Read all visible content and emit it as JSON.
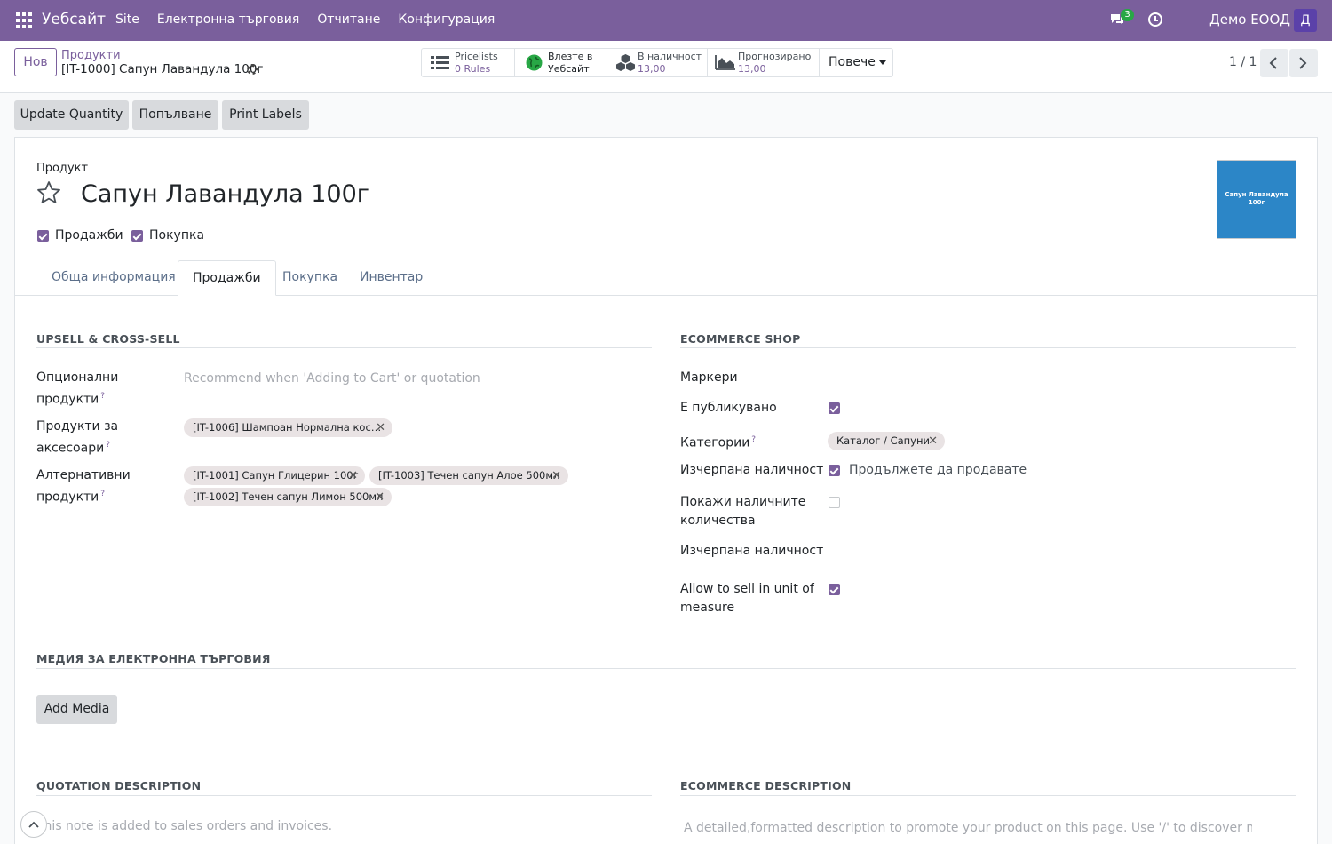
{
  "navbar": {
    "brand": "Уебсайт",
    "menu": [
      "Site",
      "Електронна търговия",
      "Отчитане",
      "Конфигурация"
    ],
    "chat_count": "3",
    "company": "Демо ЕООД",
    "avatar_letter": "Д"
  },
  "control_panel": {
    "new_button": "Нов",
    "breadcrumb_parent": "Продукти",
    "breadcrumb_current": "[IT-1000] Сапун Лавандула 100г",
    "stats": {
      "pricelists_label": "Pricelists",
      "pricelists_value": "0 Rules",
      "website_line1": "Влезте в",
      "website_line2": "Уебсайт",
      "onhand_label": "В наличност",
      "onhand_value": "13,00",
      "forecast_label": "Прогнозирано",
      "forecast_value": "13,00",
      "more": "Повече"
    },
    "pager": "1 / 1"
  },
  "actions": [
    "Update Quantity",
    "Попълване",
    "Print Labels"
  ],
  "form": {
    "product_label": "Продукт",
    "title": "Сапун Лавандула 100г",
    "image_text": "Сапун Лавандула 100г",
    "sales_check_label": "Продажби",
    "purchase_check_label": "Покупка",
    "tabs": [
      "Обща информация",
      "Продажби",
      "Покупка",
      "Инвентар"
    ],
    "active_tab": "Продажби",
    "upsell": {
      "title": "UPSELL & CROSS-SELL",
      "optional_label": "Опционални продукти",
      "optional_placeholder": "Recommend when 'Adding to Cart' or quotation",
      "accessory_label": "Продукти за аксесоари",
      "accessory_tags": [
        "[IT-1006] Шампоан Нормална кос…"
      ],
      "alternative_label": "Алтернативни продукти",
      "alternative_tags": [
        "[IT-1001] Сапун Глицерин 100г",
        "[IT-1003] Течен сапун Алое 500мл",
        "[IT-1002] Течен сапун Лимон 500мл"
      ]
    },
    "ecommerce": {
      "title": "ECOMMERCE SHOP",
      "markers_label": "Маркери",
      "published_label": "Е публикувано",
      "categories_label": "Категории",
      "category_tag": "Каталог / Сапуни",
      "out_of_stock_label": "Изчерпана наличност",
      "continue_selling": "Продължете да продавате",
      "show_qty_label": "Покажи наличните количества",
      "out_of_stock_msg_label": "Изчерпана наличност",
      "sell_uom_label": "Allow to sell in unit of measure"
    },
    "media": {
      "title": "МЕДИЯ ЗА ЕЛЕКТРОННА ТЪРГОВИЯ",
      "add_button": "Add Media"
    },
    "quotation": {
      "title": "QUOTATION DESCRIPTION",
      "placeholder": "This note is added to sales orders and invoices."
    },
    "ecom_description": {
      "title": "ECOMMERCE DESCRIPTION",
      "placeholder": "A detailed,formatted description to promote your product on this page. Use '/' to discover more feat…"
    }
  },
  "colors": {
    "navbar": "#7a5f9c",
    "accent": "#7a5f9c",
    "image_bg": "#2c86c7"
  }
}
